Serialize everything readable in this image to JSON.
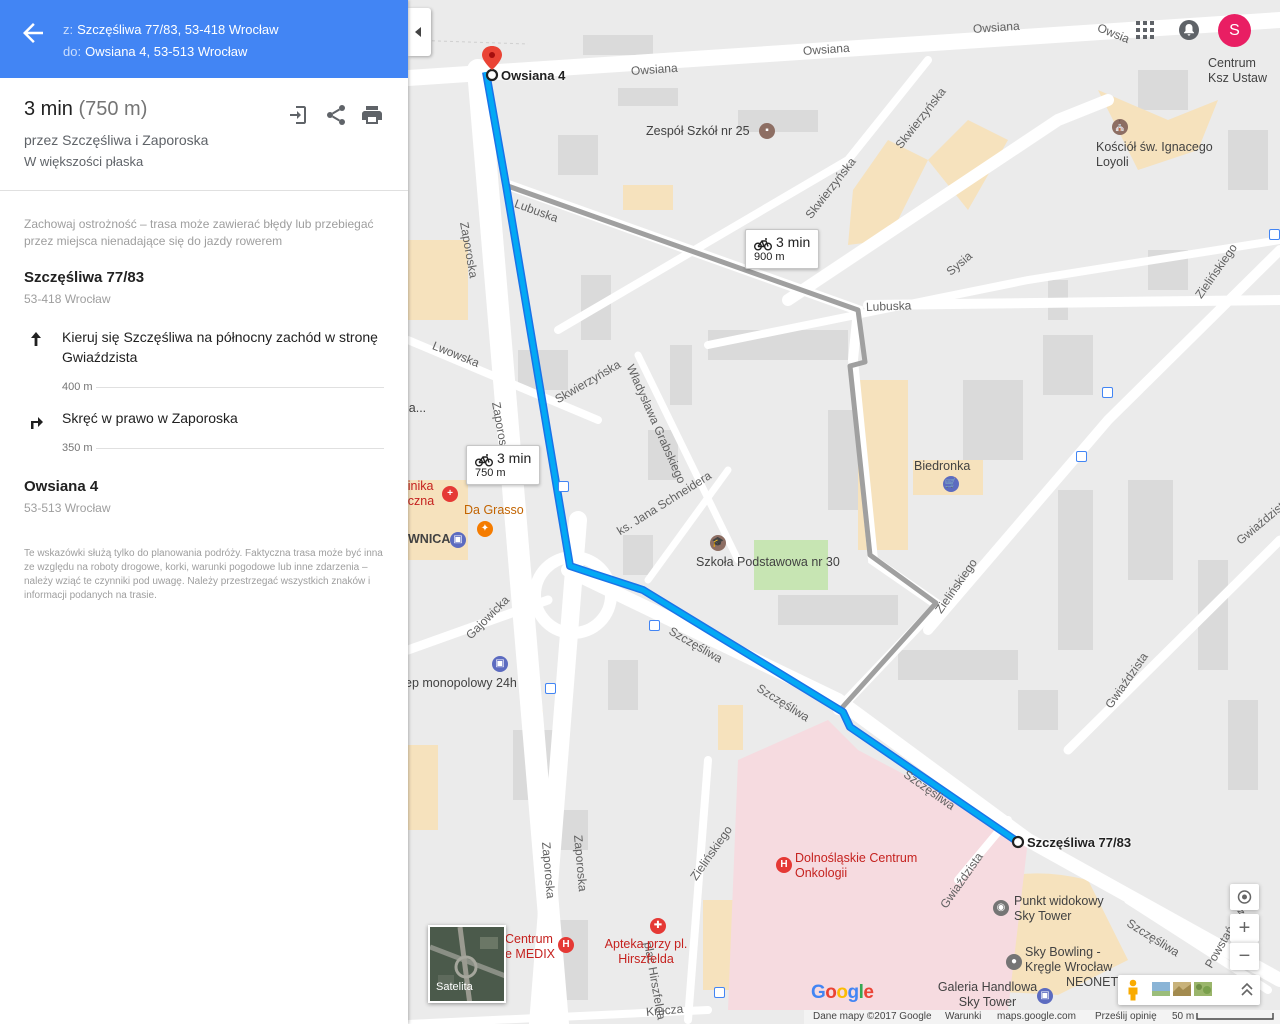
{
  "header": {
    "from_prefix": "z:",
    "from_value": "Szczęśliwa 77/83, 53-418 Wrocław",
    "to_prefix": "do:",
    "to_value": "Owsiana 4, 53-513 Wrocław"
  },
  "summary": {
    "time": "3 min",
    "distance": "(750 m)",
    "via": "przez Szczęśliwa i Zaporoska",
    "terrain": "W większości płaska"
  },
  "warning": "Zachowaj ostrożność – trasa może zawierać błędy lub przebiegać przez miejsca nienadające się do jazdy rowerem",
  "start": {
    "title": "Szczęśliwa 77/83",
    "subtitle": "53-418 Wrocław"
  },
  "steps": [
    {
      "icon": "arrow-up-icon",
      "text": "Kieruj się Szczęśliwa na północny zachód w stronę Gwiaździsta",
      "distance": "400 m"
    },
    {
      "icon": "turn-right-icon",
      "text": "Skręć w prawo w Zaporoska",
      "distance": "350 m"
    }
  ],
  "end": {
    "title": "Owsiana 4",
    "subtitle": "53-513 Wrocław"
  },
  "disclaimer": "Te wskazówki służą tylko do planowania podróży. Faktyczna trasa może być inna ze względu na roboty drogowe, korki, warunki pogodowe lub inne zdarzenia – należy wziąć te czynniki pod uwagę. Należy przestrzegać wszystkich znaków i informacji podanych na trasie.",
  "map": {
    "bubble_main": {
      "time": "3 min",
      "distance": "750 m"
    },
    "bubble_alt": {
      "time": "3 min",
      "distance": "900 m"
    },
    "origin_label": "Szczęśliwa 77/83",
    "destination_label": "Owsiana 4",
    "streets": {
      "owsiana1": "Owsiana",
      "owsiana2": "Owsiana",
      "owsiana3": "Owsiana",
      "owsiana4": "Owsia",
      "lubuska1": "Lubuska",
      "lubuska2": "Lubuska",
      "zaporoska1": "Zaporoska",
      "zaporoska2": "Zaporoska",
      "zaporoska3": "Zaporoska",
      "zaporoska4": "Zaporoska",
      "skwierzynska1": "Skwierzyńska",
      "skwierzynska2": "Skwierzyńska",
      "skwierzynska3": "Skwierzyńska",
      "lwowska": "Lwowska",
      "sysia": "Sysia",
      "grabskiego": "Władysława Grabskiego",
      "schneidera": "ks. Jana Schneidera",
      "gajowicka": "Gajowicka",
      "szczesliwa1": "Szczęśliwa",
      "szczesliwa2": "Szczęśliwa",
      "szczesliwa3": "Szczęśliwa",
      "szczesliwa4": "Szczęśliwa",
      "zelinskiego1": "Zielińskiego",
      "zelinskiego2": "Zielińskiego",
      "zelinskiego3": "Zielińskiego",
      "gwiazdzista1": "Gwiaździsta",
      "gwiazdzista2": "Gwiaździsta",
      "gwiazdzista3": "Gwiaździsta",
      "hirszfelda": "plac Hirszfelda",
      "krucza": "Krucza",
      "powstancow": "Powstańców Śl."
    },
    "pois": {
      "zespol": "Zespół Szkół nr 25",
      "kosciol": "Kościół św. Ignacego Loyoli",
      "centrum": "Centrum Ksz Ustaw",
      "biedronka": "Biedronka",
      "szkola": "Szkoła Podstawowa nr 30",
      "klinika": "linika iczna",
      "dagrasso": "Da Grasso",
      "wnica": "WNICA",
      "sklep": "ep monopolowy 24h",
      "la": "la...",
      "dolnoslaskie": "Dolnośląskie Centrum Onkologii",
      "medix": "Centrum e MEDIX",
      "apteka": "Apteka przy pl. Hirszfelda",
      "punkt": "Punkt widokowy Sky Tower",
      "bowling": "Sky Bowling - Kręgle Wrocław",
      "neonet": "NEONET",
      "galeria": "Galeria Handlowa Sky Tower"
    },
    "avatar_letter": "S",
    "satellite_label": "Satelita",
    "footer": {
      "data": "Dane mapy ©2017 Google",
      "terms": "Warunki",
      "site": "maps.google.com",
      "feedback": "Prześlij opinię",
      "scale": "50 m"
    },
    "google_letters": [
      "G",
      "o",
      "o",
      "g",
      "l",
      "e"
    ],
    "colors": {
      "route": "#03a9f4",
      "alt_route": "#9e9e9e",
      "header": "#4285f4"
    }
  }
}
